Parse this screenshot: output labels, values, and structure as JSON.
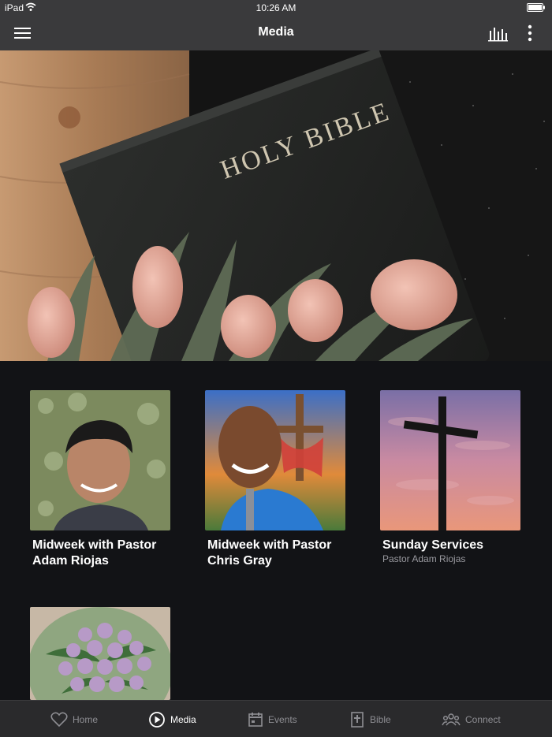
{
  "status_bar": {
    "device": "iPad",
    "time": "10:26 AM"
  },
  "header": {
    "title": "Media"
  },
  "media_items": [
    {
      "title_line1": "Midweek with Pastor",
      "title_line2": "Adam Riojas",
      "subtitle": ""
    },
    {
      "title_line1": "Midweek with Pastor",
      "title_line2": "Chris Gray",
      "subtitle": ""
    },
    {
      "title_line1": "Sunday Services",
      "title_line2": "",
      "subtitle": "Pastor Adam Riojas"
    },
    {
      "title_line1": "",
      "title_line2": "",
      "subtitle": ""
    }
  ],
  "hero": {
    "book_text": "HOLY BIBLE"
  },
  "tabs": [
    {
      "label": "Home",
      "icon": "heart-icon"
    },
    {
      "label": "Media",
      "icon": "play-circle-icon"
    },
    {
      "label": "Events",
      "icon": "calendar-icon"
    },
    {
      "label": "Bible",
      "icon": "bible-icon"
    },
    {
      "label": "Connect",
      "icon": "people-icon"
    }
  ],
  "colors": {
    "background": "#121316",
    "bar": "#3a3a3c",
    "tab_active": "#ffffff",
    "tab_inactive": "#8e8e93"
  }
}
